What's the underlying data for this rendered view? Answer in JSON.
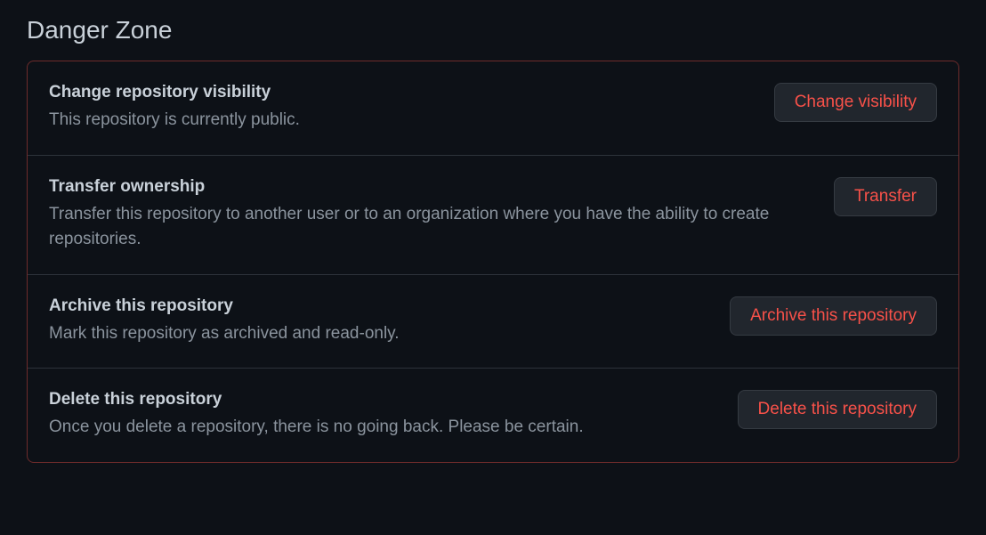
{
  "section": {
    "title": "Danger Zone"
  },
  "items": [
    {
      "title": "Change repository visibility",
      "description": "This repository is currently public.",
      "button": "Change visibility"
    },
    {
      "title": "Transfer ownership",
      "description": "Transfer this repository to another user or to an organization where you have the ability to create repositories.",
      "button": "Transfer"
    },
    {
      "title": "Archive this repository",
      "description": "Mark this repository as archived and read-only.",
      "button": "Archive this repository"
    },
    {
      "title": "Delete this repository",
      "description": "Once you delete a repository, there is no going back. Please be certain.",
      "button": "Delete this repository"
    }
  ]
}
